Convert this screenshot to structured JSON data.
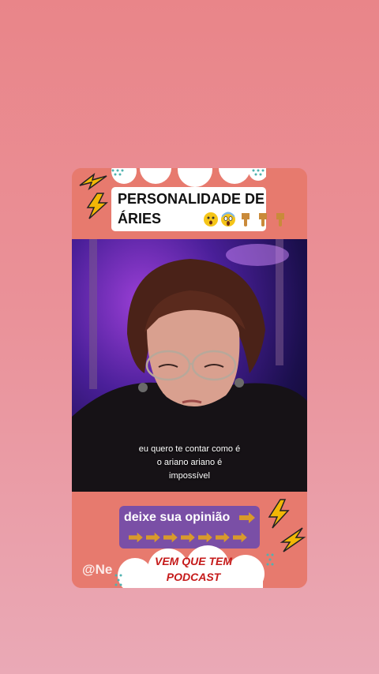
{
  "header": {
    "title_line1": "PERSONALIDADE DE",
    "title_line2": "ÁRIES"
  },
  "video": {
    "caption_lines": [
      "eu quero te contar como é",
      "o ariano ariano é",
      "impossível"
    ]
  },
  "footer": {
    "opinion_label": "deixe sua opinião",
    "podcast_line1": "VEM QUE TEM",
    "podcast_line2": "PODCAST"
  },
  "watermark": "@Ne",
  "colors": {
    "card": "#e87b6f",
    "accent_purple": "#7a4fa6",
    "podcast_red": "#c51a1a",
    "lightning": "#f2b705"
  },
  "icons": [
    "astonished-face-icon",
    "screaming-face-icon",
    "pointing-down-icon",
    "pointing-right-icon",
    "lightning-icon"
  ]
}
